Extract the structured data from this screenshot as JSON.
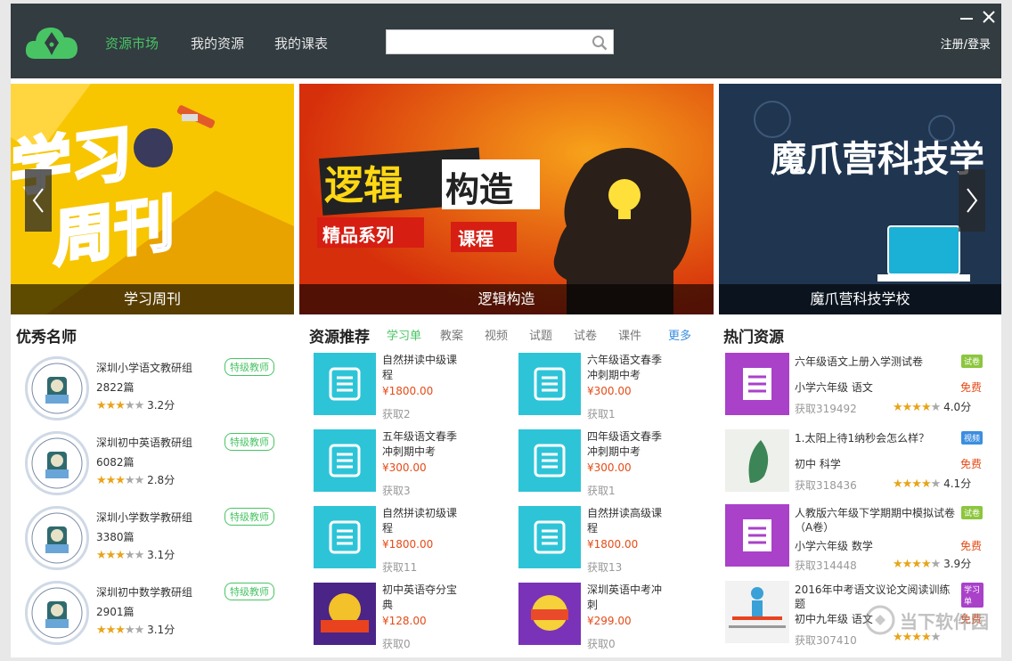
{
  "header": {
    "nav": [
      "资源市场",
      "我的资源",
      "我的课表"
    ],
    "search_placeholder": "",
    "login": "注册/登录"
  },
  "banners": [
    {
      "caption": "学习周刊",
      "art_text": [
        "学习",
        "周刊"
      ]
    },
    {
      "caption": "逻辑构造",
      "art_text": [
        "逻辑",
        "构造",
        "精品系列",
        "课程"
      ]
    },
    {
      "caption": "魔爪营科技学校",
      "art_text": [
        "魔爪营科技学"
      ]
    }
  ],
  "teachers": {
    "title": "优秀名师",
    "items": [
      {
        "name": "深圳小学语文教研组",
        "badge": "特级教师",
        "count": "2822篇",
        "stars": 3,
        "score": "3.2分"
      },
      {
        "name": "深圳初中英语教研组",
        "badge": "特级教师",
        "count": "6082篇",
        "stars": 3,
        "score": "2.8分"
      },
      {
        "name": "深圳小学数学教研组",
        "badge": "特级教师",
        "count": "3380篇",
        "stars": 3,
        "score": "3.1分"
      },
      {
        "name": "深圳初中数学教研组",
        "badge": "特级教师",
        "count": "2901篇",
        "stars": 3,
        "score": "3.1分"
      }
    ]
  },
  "resources": {
    "title": "资源推荐",
    "tabs": [
      "学习单",
      "教案",
      "视频",
      "试题",
      "试卷",
      "课件"
    ],
    "more": "更多",
    "items": [
      {
        "title": "自然拼读中级课程",
        "price": "¥1800.00",
        "got": "获取2"
      },
      {
        "title": "六年级语文春季冲刺期中考",
        "price": "¥300.00",
        "got": "获取1"
      },
      {
        "title": "五年级语文春季冲刺期中考",
        "price": "¥300.00",
        "got": "获取3"
      },
      {
        "title": "四年级语文春季冲刺期中考",
        "price": "¥300.00",
        "got": "获取1"
      },
      {
        "title": "自然拼读初级课程",
        "price": "¥1800.00",
        "got": "获取11"
      },
      {
        "title": "自然拼读高级课程",
        "price": "¥1800.00",
        "got": "获取13"
      },
      {
        "title": "初中英语夺分宝典",
        "price": "¥128.00",
        "got": "获取0"
      },
      {
        "title": "深圳英语中考冲刺",
        "price": "¥299.00",
        "got": "获取0"
      }
    ]
  },
  "hot": {
    "title": "热门资源",
    "items": [
      {
        "title": "六年级语文上册入学测试卷",
        "kind": "试卷",
        "grade": "小学六年级 语文",
        "price": "免费",
        "got": "获取319492",
        "stars": 4,
        "score": "4.0分"
      },
      {
        "title": "1.太阳上待1纳秒会怎么样？",
        "kind": "视频",
        "grade": "初中 科学",
        "price": "免费",
        "got": "获取318436",
        "stars": 4,
        "score": "4.1分"
      },
      {
        "title": "人教版六年级下学期期中模拟试卷（A卷）",
        "kind": "试卷",
        "grade": "小学六年级 数学",
        "price": "免费",
        "got": "获取314448",
        "stars": 4,
        "score": "3.9分"
      },
      {
        "title": "2016年中考语文议论文阅读训练题",
        "kind": "学习单",
        "grade": "初中九年级 语文",
        "price": "免费",
        "got": "获取307410",
        "stars": 4,
        "score": ""
      }
    ]
  },
  "watermark": "当下软件园",
  "colors": {
    "header": "#323c41",
    "accent": "#49c464",
    "price": "#e54b17",
    "thumb": "#2ec4d8",
    "purple": "#a941c9"
  }
}
